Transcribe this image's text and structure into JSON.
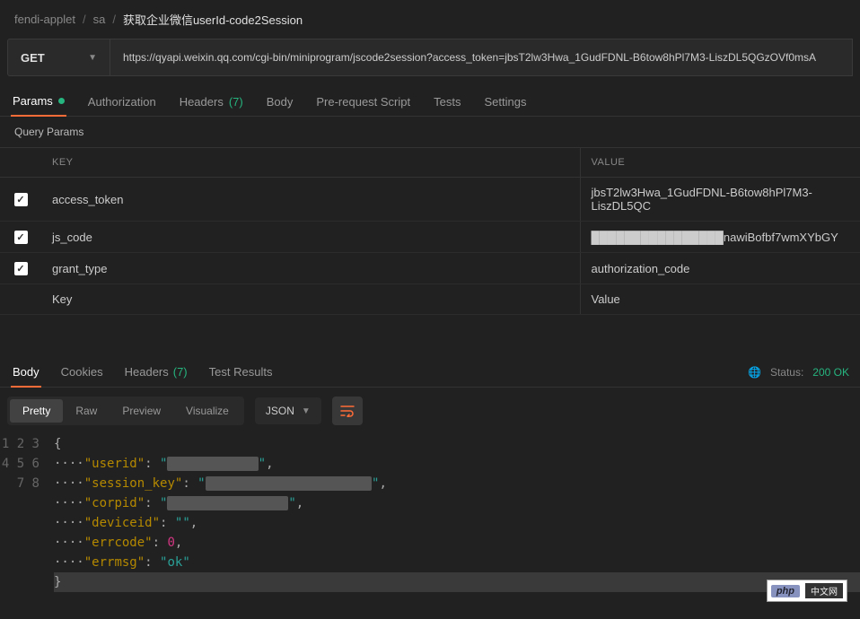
{
  "breadcrumb": {
    "workspace": "fendi-applet",
    "folder": "sa",
    "request": "获取企业微信userId-code2Session"
  },
  "request": {
    "method": "GET",
    "url": "https://qyapi.weixin.qq.com/cgi-bin/miniprogram/jscode2session?access_token=jbsT2lw3Hwa_1GudFDNL-B6tow8hPl7M3-LiszDL5QGzOVf0msA"
  },
  "tabs": {
    "params": "Params",
    "authorization": "Authorization",
    "headers": "Headers",
    "headers_count": "(7)",
    "body": "Body",
    "prerequest": "Pre-request Script",
    "tests": "Tests",
    "settings": "Settings"
  },
  "params_section": {
    "title": "Query Params",
    "key_header": "KEY",
    "value_header": "VALUE",
    "key_placeholder": "Key",
    "value_placeholder": "Value",
    "rows": [
      {
        "checked": true,
        "key": "access_token",
        "value": "jbsT2lw3Hwa_1GudFDNL-B6tow8hPl7M3-LiszDL5QC"
      },
      {
        "checked": true,
        "key": "js_code",
        "value": "████████████████nawiBofbf7wmXYbGY"
      },
      {
        "checked": true,
        "key": "grant_type",
        "value": "authorization_code"
      }
    ]
  },
  "response": {
    "tabs": {
      "body": "Body",
      "cookies": "Cookies",
      "headers": "Headers",
      "headers_count": "(7)",
      "test_results": "Test Results"
    },
    "status_label": "Status:",
    "status_value": "200 OK",
    "views": {
      "pretty": "Pretty",
      "raw": "Raw",
      "preview": "Preview",
      "visualize": "Visualize"
    },
    "format": "JSON",
    "body": {
      "userid_key": "userid",
      "userid_val": "████████████",
      "session_key_key": "session_key",
      "session_key_val": "██████████████████████",
      "corpid_key": "corpid",
      "corpid_val": "████████████████",
      "deviceid_key": "deviceid",
      "deviceid_val": "",
      "errcode_key": "errcode",
      "errcode_val": "0",
      "errmsg_key": "errmsg",
      "errmsg_val": "ok"
    }
  },
  "badge": {
    "php": "php",
    "cn": "中文网"
  }
}
